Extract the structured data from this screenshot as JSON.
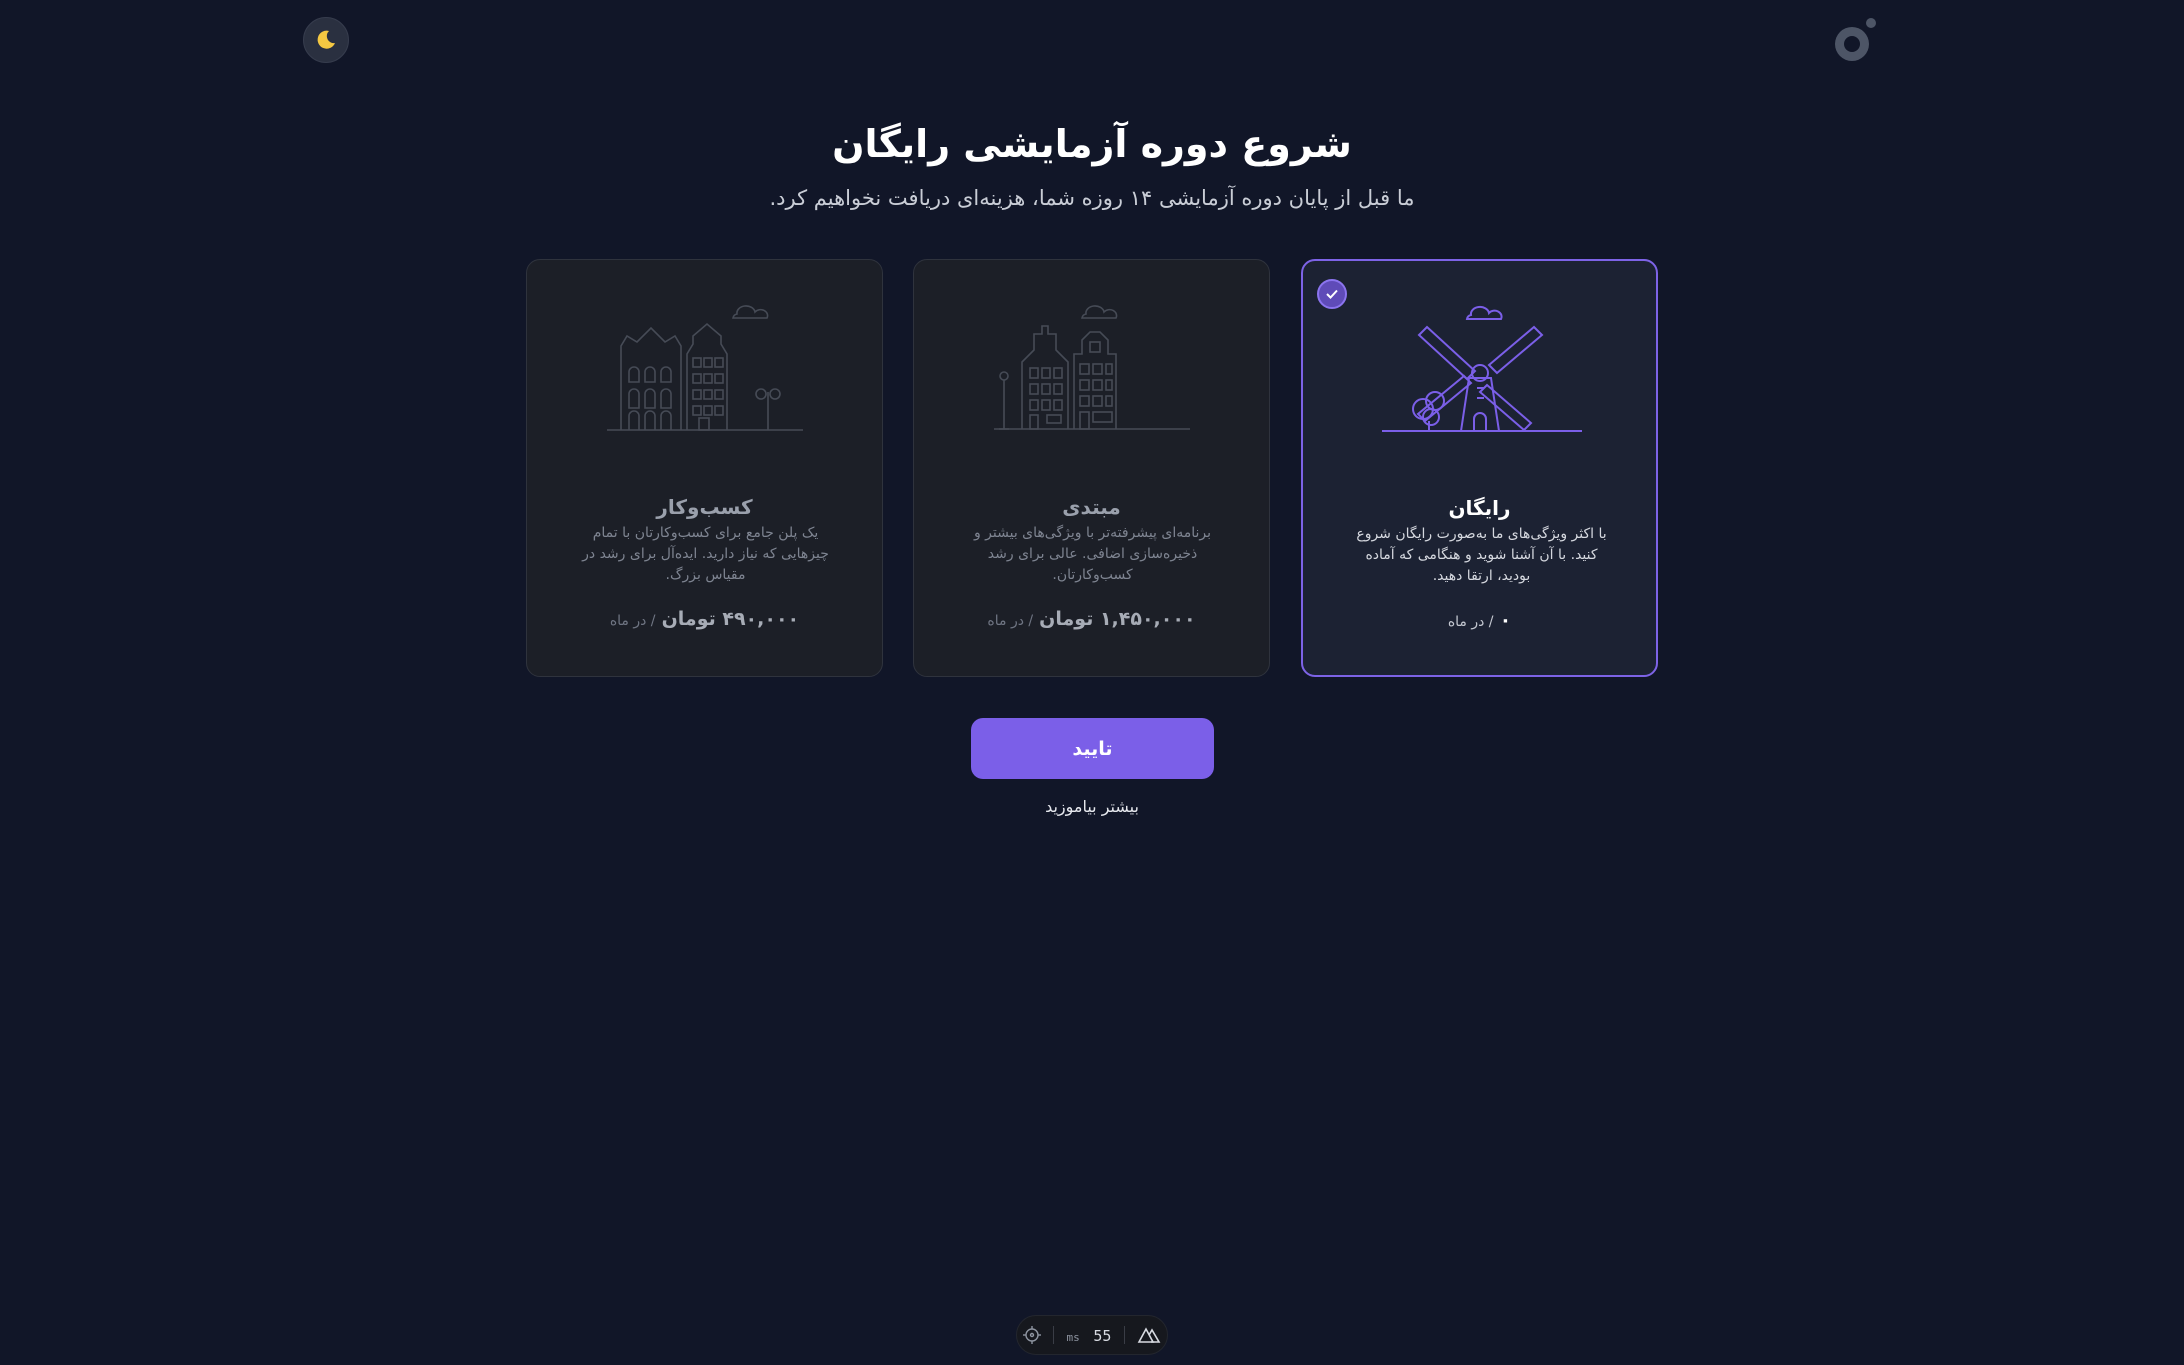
{
  "header": {
    "theme_toggle": "moon-icon",
    "logo": "brand-logo"
  },
  "title": "شروع دوره آزمایشی رایگان",
  "subtitle": "ما قبل از پایان دوره آزمایشی ۱۴ روزه شما، هزینه‌ای دریافت نخواهیم کرد.",
  "plans": [
    {
      "name": "رایگان",
      "description": "با اکثر ویژگی‌های ما به‌صورت رایگان شروع کنید. با آن آشنا شوید و هنگامی که آماده بودید، ارتقا دهید.",
      "amount": "۰",
      "per": "/ در ماه",
      "selected": true,
      "illustration": "windmill"
    },
    {
      "name": "مبتدی",
      "description": "برنامه‌ای پیشرفته‌تر با ویژگی‌های بیشتر و ذخیره‌سازی اضافی. عالی برای رشد کسب‌وکارتان.",
      "amount": "۱,۴۵۰,۰۰۰ تومان",
      "per": "/ در ماه",
      "selected": false,
      "illustration": "houses"
    },
    {
      "name": "کسب‌وکار",
      "description": "یک پلن جامع برای کسب‌وکارتان با تمام چیزهایی که نیاز دارید. ایده‌آل برای رشد در مقیاس بزرگ.",
      "amount": "۴۹۰,۰۰۰ تومان",
      "per": "/ در ماه",
      "selected": false,
      "illustration": "buildings"
    }
  ],
  "confirm_label": "تایید",
  "learn_more_label": "بیشتر بیاموزید",
  "devbar": {
    "value": "55",
    "unit": "ms"
  },
  "colors": {
    "background": "#111628",
    "accent": "#7b5fe8",
    "card": "#1c1f27"
  }
}
